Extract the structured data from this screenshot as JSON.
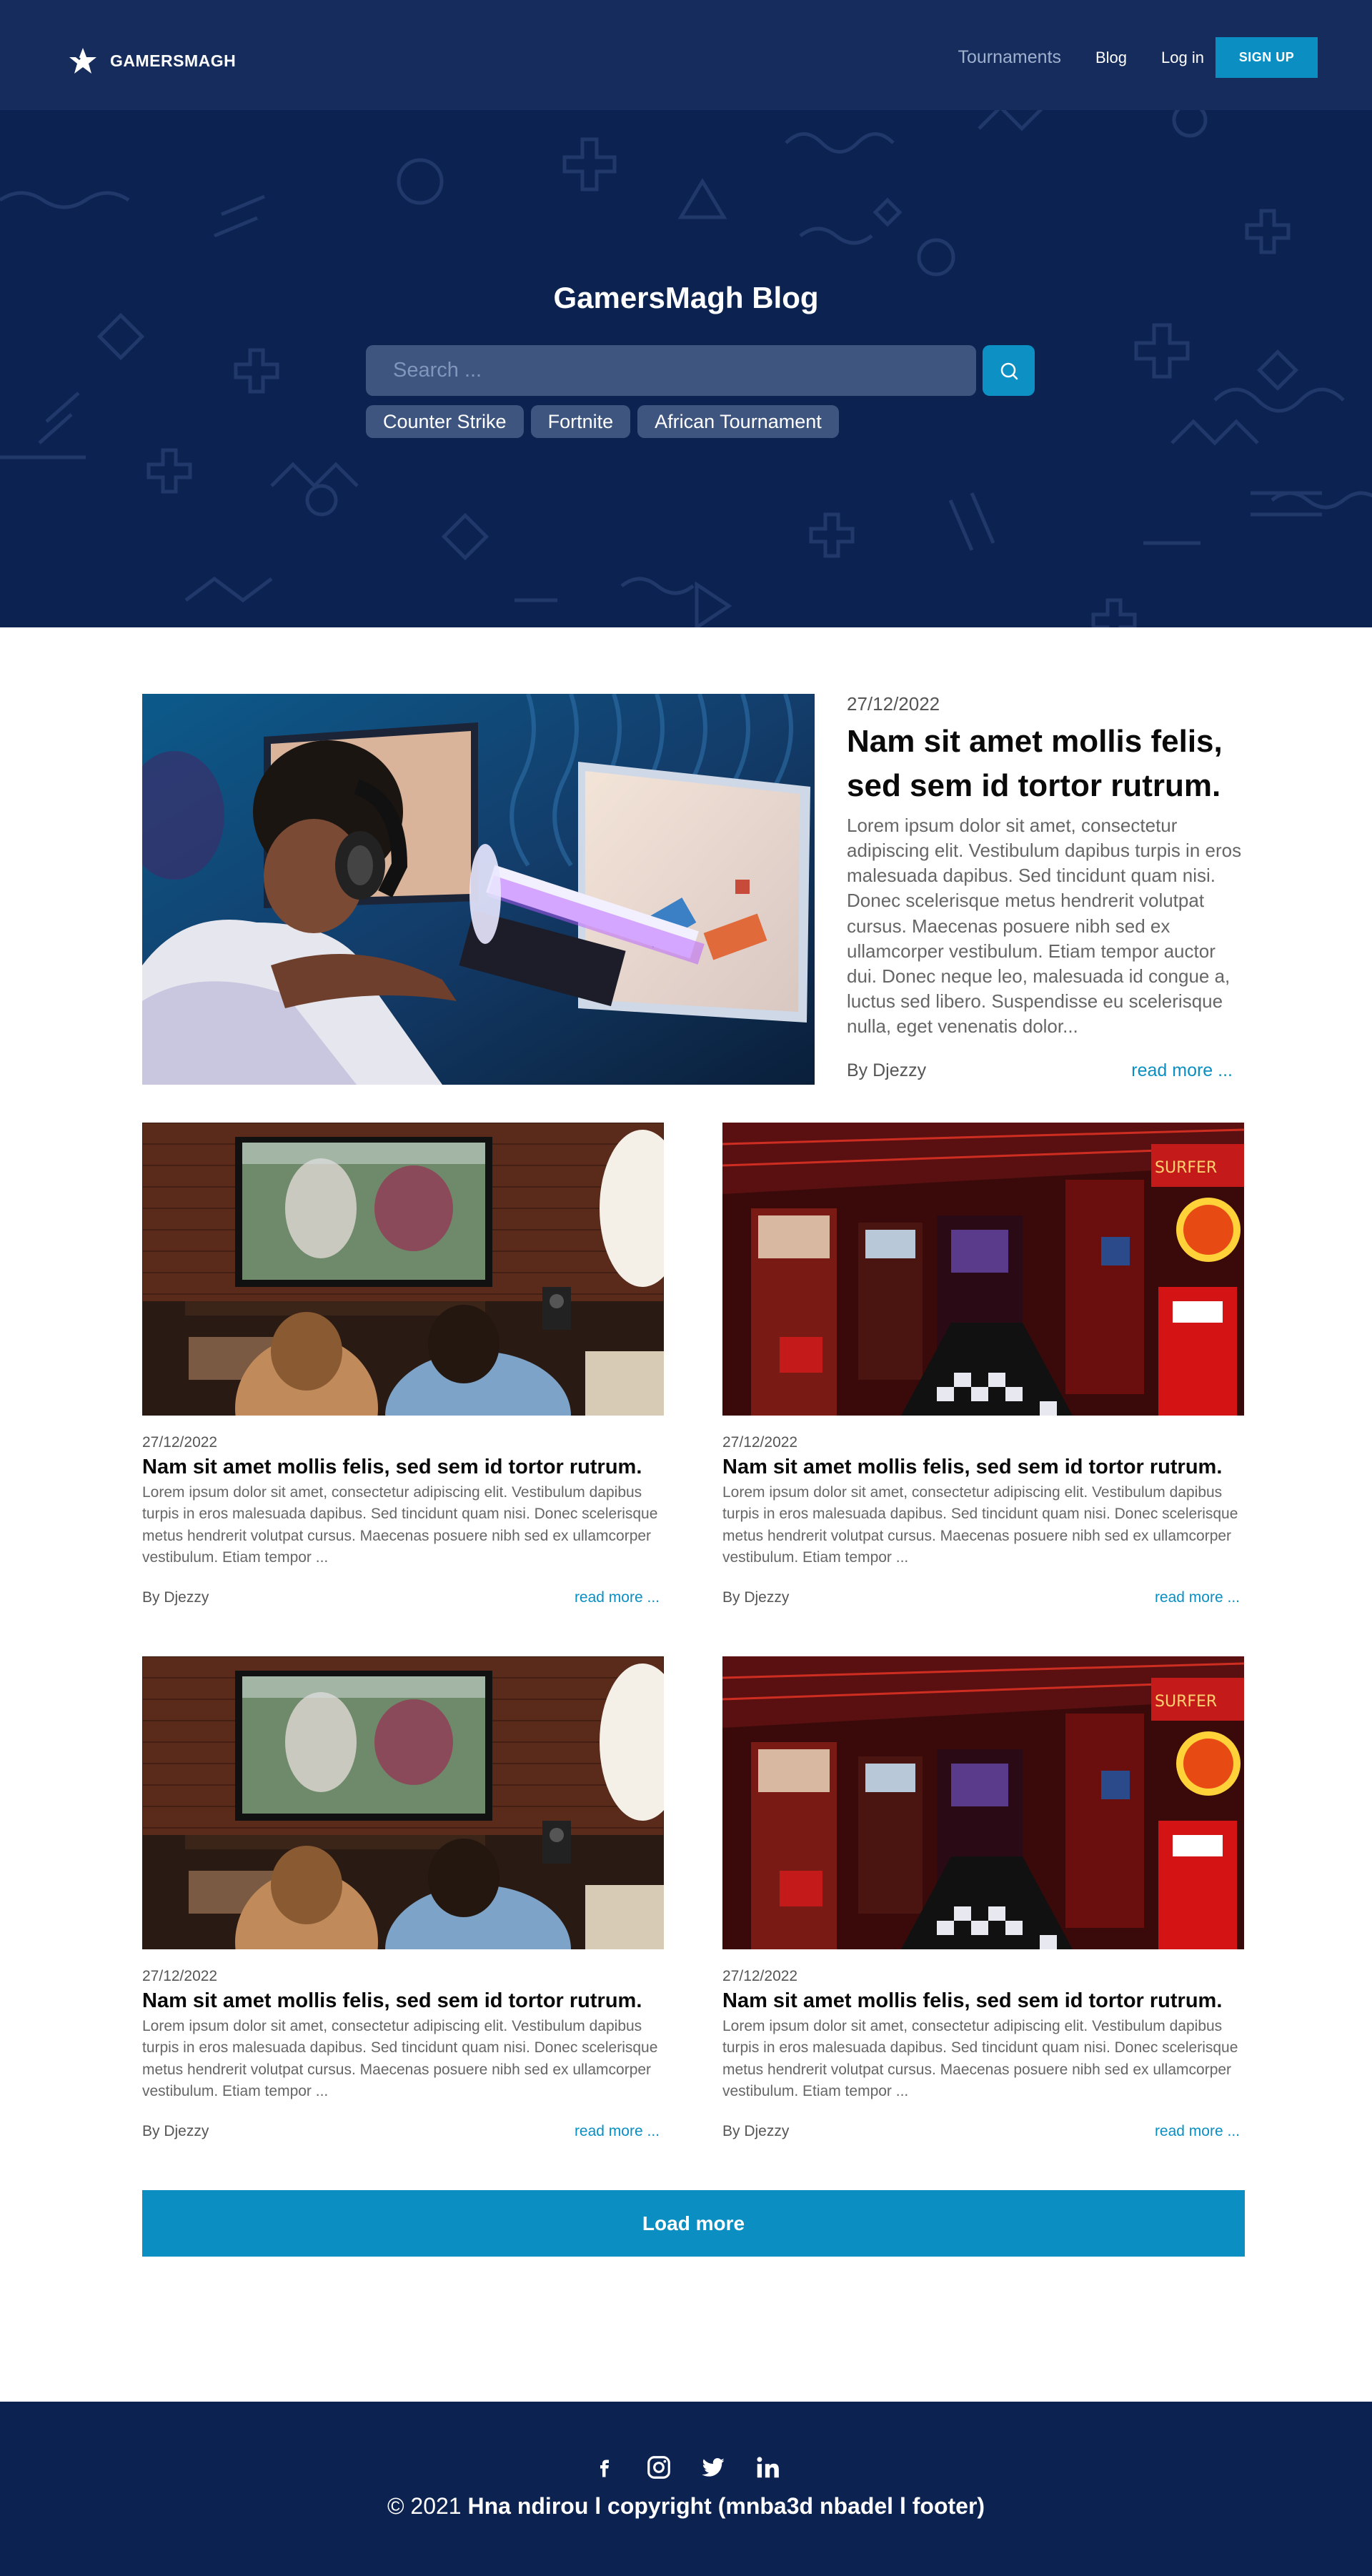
{
  "brand": {
    "name": "GAMERSMAGH"
  },
  "nav": {
    "tournaments": "Tournaments",
    "blog": "Blog",
    "login": "Log in",
    "signup": "SIGN UP"
  },
  "hero": {
    "title": "GamersMagh Blog",
    "search_placeholder": "Search ...",
    "tags": [
      "Counter Strike",
      "Fortnite",
      "African Tournament"
    ]
  },
  "featured": {
    "date": "27/12/2022",
    "title": "Nam sit amet mollis felis, sed sem id tortor rutrum.",
    "excerpt": "Lorem ipsum dolor sit amet, consectetur adipiscing elit. Vestibulum dapibus turpis in eros malesuada dapibus. Sed tincidunt quam nisi. Donec scelerisque metus hendrerit volutpat cursus. Maecenas posuere nibh sed ex ullamcorper vestibulum. Etiam tempor auctor dui. Donec neque leo, malesuada id congue a, luctus sed libero. Suspendisse eu scelerisque nulla, eget venenatis dolor...",
    "author": "By Djezzy",
    "read_more": "read more ..."
  },
  "posts": [
    {
      "image": "living-room-gaming",
      "date": "27/12/2022",
      "title": "Nam sit amet mollis felis, sed sem id tortor rutrum.",
      "excerpt": "Lorem ipsum dolor sit amet, consectetur adipiscing elit. Vestibulum dapibus turpis in eros malesuada dapibus. Sed tincidunt quam nisi. Donec scelerisque metus hendrerit volutpat cursus. Maecenas posuere nibh sed ex ullamcorper vestibulum. Etiam tempor ...",
      "author": "By Djezzy",
      "read_more": "read more ..."
    },
    {
      "image": "arcade-hall",
      "date": "27/12/2022",
      "title": "Nam sit amet mollis felis, sed sem id tortor rutrum.",
      "excerpt": "Lorem ipsum dolor sit amet, consectetur adipiscing elit. Vestibulum dapibus turpis in eros malesuada dapibus. Sed tincidunt quam nisi. Donec scelerisque metus hendrerit volutpat cursus. Maecenas posuere nibh sed ex ullamcorper vestibulum. Etiam tempor ...",
      "author": "By Djezzy",
      "read_more": "read more ..."
    },
    {
      "image": "living-room-gaming",
      "date": "27/12/2022",
      "title": "Nam sit amet mollis felis, sed sem id tortor rutrum.",
      "excerpt": "Lorem ipsum dolor sit amet, consectetur adipiscing elit. Vestibulum dapibus turpis in eros malesuada dapibus. Sed tincidunt quam nisi. Donec scelerisque metus hendrerit volutpat cursus. Maecenas posuere nibh sed ex ullamcorper vestibulum. Etiam tempor ...",
      "author": "By Djezzy",
      "read_more": "read more ..."
    },
    {
      "image": "arcade-hall",
      "date": "27/12/2022",
      "title": "Nam sit amet mollis felis, sed sem id tortor rutrum.",
      "excerpt": "Lorem ipsum dolor sit amet, consectetur adipiscing elit. Vestibulum dapibus turpis in eros malesuada dapibus. Sed tincidunt quam nisi. Donec scelerisque metus hendrerit volutpat cursus. Maecenas posuere nibh sed ex ullamcorper vestibulum. Etiam tempor ...",
      "author": "By Djezzy",
      "read_more": "read more ..."
    }
  ],
  "load_more": "Load more",
  "footer": {
    "socials": [
      "facebook-icon",
      "instagram-icon",
      "twitter-icon",
      "linkedin-icon"
    ],
    "copyright_prefix": "© 2021",
    "copyright_bold": "Hna ndirou l copyright (mnba3d nbadel l footer)"
  },
  "colors": {
    "hero_bg": "#0c2250",
    "navbar_bg": "#152c5c",
    "accent": "#0b8fc2",
    "tag_bg": "#3d557f"
  }
}
